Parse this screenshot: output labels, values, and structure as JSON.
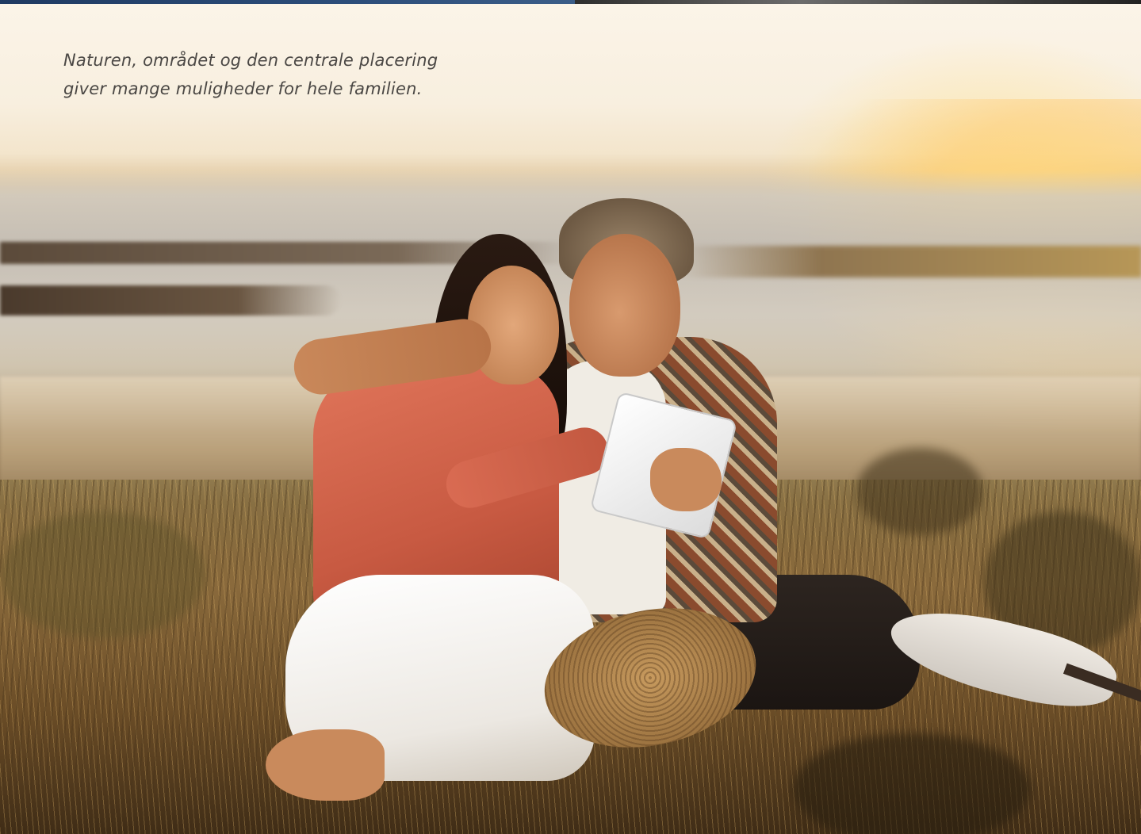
{
  "caption": {
    "line1": "Naturen, området og den centrale placering",
    "line2": "giver mange muligheder for hele familien."
  },
  "hero_image": {
    "subject": "couple-on-grassy-dune-at-sunset-with-tablet",
    "colors": {
      "sky": "#fbf4e8",
      "sun": "#ffd678",
      "grass": "#8a6a3c",
      "woman_top": "#d96b52",
      "pants": "#ffffff"
    }
  },
  "top_strip": {
    "left_color": "#2c4d7a",
    "right_color": "#3a3a3a"
  }
}
